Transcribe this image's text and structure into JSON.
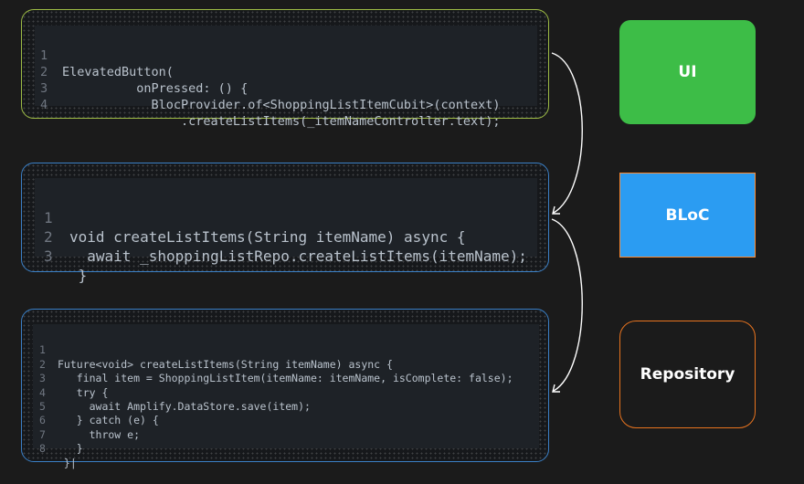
{
  "code_blocks": [
    {
      "id": "ui",
      "lines": [
        {
          "n": "1",
          "text": "ElevatedButton("
        },
        {
          "n": "2",
          "text": "          onPressed: () {"
        },
        {
          "n": "3",
          "text": "            BlocProvider.of<ShoppingListItemCubit>(context)"
        },
        {
          "n": "4",
          "text": "                .createListItems(_itemNameController.text);"
        }
      ]
    },
    {
      "id": "bloc",
      "lines": [
        {
          "n": "1",
          "text": "void createListItems(String itemName) async {"
        },
        {
          "n": "2",
          "text": "  await _shoppingListRepo.createListItems(itemName);"
        },
        {
          "n": "3",
          "text": " }"
        }
      ]
    },
    {
      "id": "repository",
      "lines": [
        {
          "n": "1",
          "text": "Future<void> createListItems(String itemName) async {"
        },
        {
          "n": "2",
          "text": "   final item = ShoppingListItem(itemName: itemName, isComplete: false);"
        },
        {
          "n": "3",
          "text": "   try {"
        },
        {
          "n": "4",
          "text": "     await Amplify.DataStore.save(item);"
        },
        {
          "n": "5",
          "text": "   } catch (e) {"
        },
        {
          "n": "6",
          "text": "     throw e;"
        },
        {
          "n": "7",
          "text": "   }"
        },
        {
          "n": "8",
          "text": " }|"
        }
      ]
    }
  ],
  "layers": {
    "ui": {
      "label": "UI",
      "color": "#3dbd47"
    },
    "bloc": {
      "label": "BLoC",
      "color": "#2b9cf2"
    },
    "repository": {
      "label": "Repository",
      "color": "#e8741f"
    }
  },
  "colors": {
    "background": "#1b1b1b",
    "ui_border": "#9dbb45",
    "bloc_border": "#3b80c7",
    "arrow": "#ffffff"
  }
}
